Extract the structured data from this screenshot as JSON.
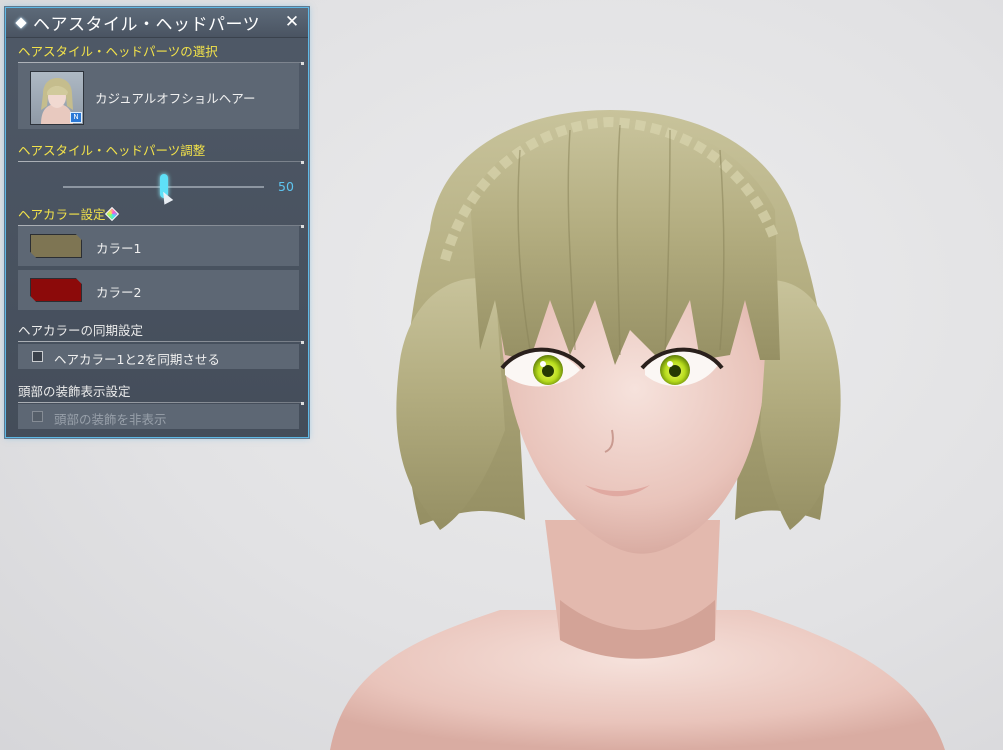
{
  "panel": {
    "title": "ヘアスタイル・ヘッドパーツ",
    "close_icon": "close-icon"
  },
  "hair_select": {
    "heading": "ヘアスタイル・ヘッドパーツの選択",
    "item_name": "カジュアルオフショルヘアー",
    "thumb_badge": "N"
  },
  "hair_adjust": {
    "heading": "ヘアスタイル・ヘッドパーツ調整",
    "value_label": "50",
    "value": 50,
    "min": 0,
    "max": 100
  },
  "hair_color": {
    "heading": "ヘアカラー設定",
    "colors": [
      {
        "label": "カラー1",
        "swatch": "#7e7553"
      },
      {
        "label": "カラー2",
        "swatch": "#8c0a0a"
      }
    ]
  },
  "color_sync": {
    "heading": "ヘアカラーの同期設定",
    "checkbox_label": "ヘアカラー1と2を同期させる",
    "checked": false
  },
  "head_deco": {
    "heading": "頭部の装飾表示設定",
    "checkbox_label": "頭部の装飾を非表示",
    "checked": false,
    "disabled": true
  },
  "colors": {
    "accent": "#5ee0f8",
    "heading": "#f2e24a",
    "panel_border": "#5fb9e6"
  }
}
